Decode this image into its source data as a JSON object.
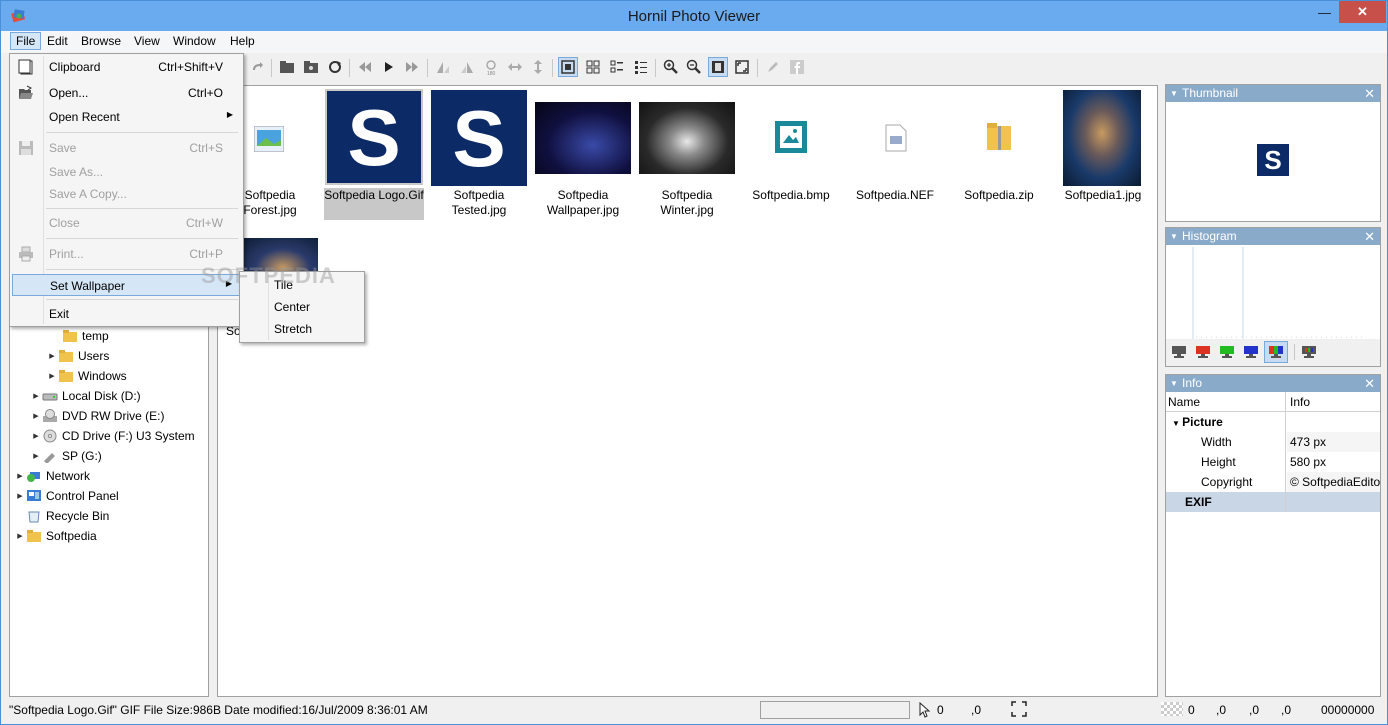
{
  "window": {
    "title": "Hornil Photo Viewer",
    "minimize_glyph": "—",
    "close_glyph": "✕"
  },
  "menubar": {
    "items": [
      "File",
      "Edit",
      "Browse",
      "View",
      "Window",
      "Help"
    ]
  },
  "file_menu": {
    "items": [
      {
        "label": "Clipboard",
        "shortcut": "Ctrl+Shift+V",
        "icon": "clipboard-icon"
      },
      {
        "label": "Open...",
        "shortcut": "Ctrl+O",
        "icon": "open-folder-icon"
      },
      {
        "label": "Open Recent",
        "shortcut": "",
        "icon": ""
      },
      {
        "label": "Save",
        "shortcut": "Ctrl+S",
        "icon": "save-icon"
      },
      {
        "label": "Save As...",
        "shortcut": "",
        "icon": ""
      },
      {
        "label": "Save A Copy...",
        "shortcut": "",
        "icon": ""
      },
      {
        "label": "Close",
        "shortcut": "Ctrl+W",
        "icon": ""
      },
      {
        "label": "Print...",
        "shortcut": "Ctrl+P",
        "icon": "print-icon"
      },
      {
        "label": "Set Wallpaper",
        "shortcut": "",
        "icon": ""
      },
      {
        "label": "Exit",
        "shortcut": "",
        "icon": ""
      }
    ]
  },
  "wallpaper_submenu": {
    "items": [
      "Tile",
      "Center",
      "Stretch"
    ]
  },
  "watermark": "SOFTPEDIA",
  "tree": {
    "items": [
      {
        "label": "temp"
      },
      {
        "label": "Users"
      },
      {
        "label": "Windows"
      },
      {
        "label": "Local Disk (D:)"
      },
      {
        "label": "DVD RW Drive (E:)"
      },
      {
        "label": "CD Drive (F:) U3 System"
      },
      {
        "label": "SP (G:)"
      },
      {
        "label": "Network"
      },
      {
        "label": "Control Panel"
      },
      {
        "label": "Recycle Bin"
      },
      {
        "label": "Softpedia"
      }
    ]
  },
  "thumbnails": {
    "items": [
      {
        "label1": "Softpedia",
        "label2": "Forest.jpg"
      },
      {
        "label1": "Softpedia Logo.Gif",
        "label2": ""
      },
      {
        "label1": "Softpedia",
        "label2": "Tested.jpg"
      },
      {
        "label1": "Softpedia",
        "label2": "Wallpaper.jpg"
      },
      {
        "label1": "Softpedia",
        "label2": "Winter.jpg"
      },
      {
        "label1": "Softpedia.bmp",
        "label2": ""
      },
      {
        "label1": "Softpedia.NEF",
        "label2": ""
      },
      {
        "label1": "Softpedia.zip",
        "label2": ""
      },
      {
        "label1": "Softpedia1.jpg",
        "label2": ""
      }
    ],
    "partial_label": "So",
    "logo_letter": "S"
  },
  "panels": {
    "thumbnail": {
      "title": "Thumbnail",
      "logo_letter": "S"
    },
    "histogram": {
      "title": "Histogram"
    },
    "info": {
      "title": "Info",
      "col_name": "Name",
      "col_info": "Info",
      "group_picture": "Picture",
      "rows": [
        {
          "name": "Width",
          "value": "473 px"
        },
        {
          "name": "Height",
          "value": "580 px"
        },
        {
          "name": "Copyright",
          "value": "© SoftpediaEdito"
        }
      ],
      "group_exif": "EXIF"
    }
  },
  "statusbar": {
    "file_info": "\"Softpedia Logo.Gif\" GIF File Size:986B Date modified:16/Jul/2009 8:36:01 AM",
    "cursor_x": "0",
    "cursor_y": ",0",
    "rgb_r": "0",
    "rgb_g": ",0",
    "rgb_b": ",0",
    "rgb_a": ",0",
    "hex": "00000000"
  },
  "colors": {
    "titlebar": "#6aaaee",
    "close": "#c7504a",
    "panel_header": "#8aaac9",
    "logo_bg": "#0b2a66"
  }
}
